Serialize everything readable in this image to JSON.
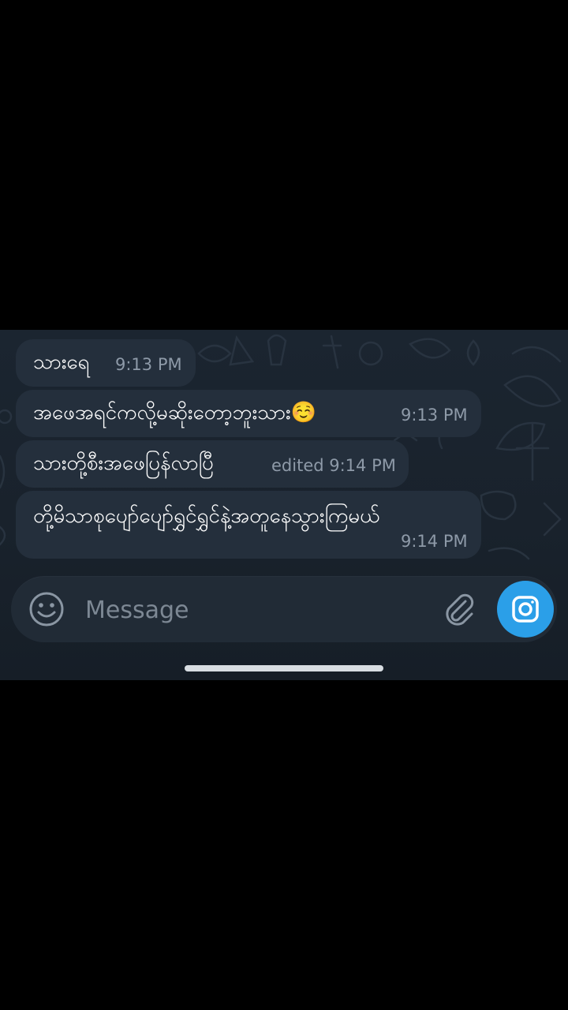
{
  "messages": [
    {
      "text": "သားရေ",
      "time": "9:13 PM"
    },
    {
      "text": "အဖေအရင်ကလို့မဆိုးတော့ဘူးသား",
      "emoji": "☺️",
      "time": "9:13 PM"
    },
    {
      "text": "သားတို့စီးအဖေပြန်လာပြီ",
      "time": "edited 9:14 PM"
    },
    {
      "text": "တို့မိသာစုပျော်ပျော်ရွှင်ရွှင်နဲ့အတူနေသွားကြမယ်",
      "time": "9:14 PM"
    }
  ],
  "composer": {
    "placeholder": "Message",
    "emoji_icon": "smiley-face-icon",
    "attach_icon": "paperclip-icon",
    "camera_icon": "camera-icon"
  },
  "colors": {
    "bubble": "#242f3c",
    "accent": "#2b9fe8",
    "timestamp": "#8e9aa8"
  }
}
